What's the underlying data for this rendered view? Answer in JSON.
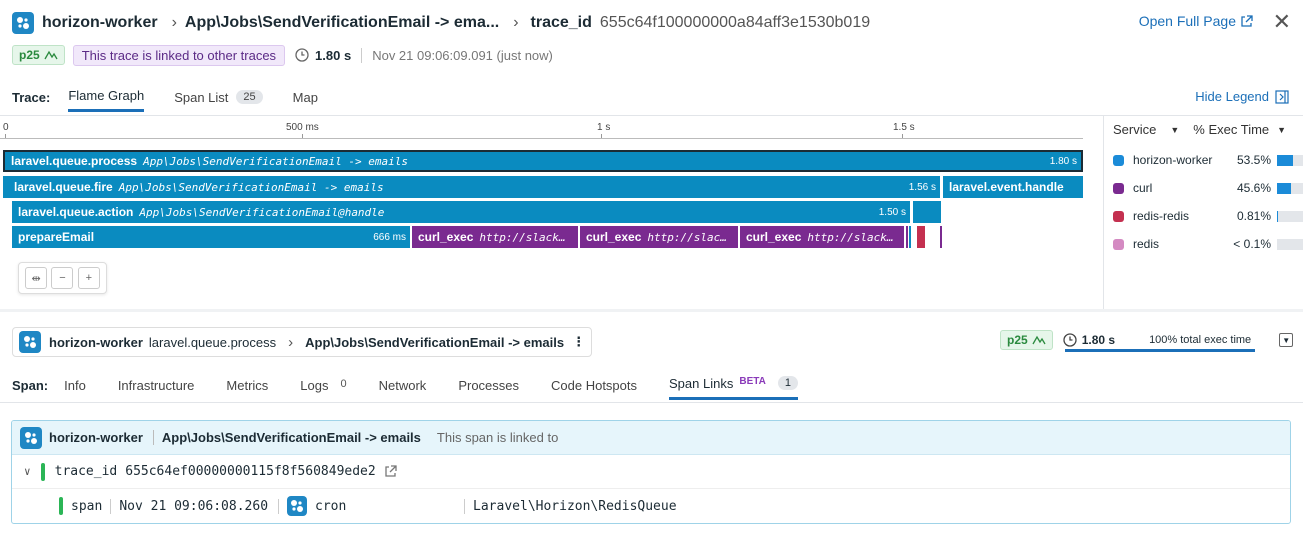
{
  "header": {
    "service": "horizon-worker",
    "resource": "App\\Jobs\\SendVerificationEmail -> ema...",
    "trace_id_label": "trace_id",
    "trace_id": "655c64f100000000a84aff3e1530b019",
    "open_full_page": "Open Full Page"
  },
  "subheader": {
    "percentile": "p25",
    "linked_text": "This trace is linked to other traces",
    "duration": "1.80 s",
    "timestamp": "Nov 21 09:06:09.091 (just now)"
  },
  "tabs": {
    "label": "Trace:",
    "items": [
      "Flame Graph",
      "Span List",
      "Map"
    ],
    "span_list_count": "25",
    "hide_legend": "Hide Legend"
  },
  "flame": {
    "ticks": [
      "0",
      "500 ms",
      "1 s",
      "1.5 s"
    ],
    "rows": [
      {
        "name": "laravel.queue.process",
        "resource": "App\\Jobs\\SendVerificationEmail -> emails",
        "duration": "1.80 s"
      },
      {
        "name": "laravel.queue.fire",
        "resource": "App\\Jobs\\SendVerificationEmail -> emails",
        "duration": "1.56 s"
      },
      {
        "name": "laravel.event.handle",
        "resource": "",
        "duration": ""
      },
      {
        "name": "laravel.queue.action",
        "resource": "App\\Jobs\\SendVerificationEmail@handle",
        "duration": "1.50 s"
      },
      {
        "name": "prepareEmail",
        "resource": "",
        "duration": "666 ms"
      },
      {
        "name": "curl_exec",
        "resource": "http://slack…",
        "duration": ""
      },
      {
        "name": "curl_exec",
        "resource": "http://slac…",
        "duration": ""
      },
      {
        "name": "curl_exec",
        "resource": "http://slack…",
        "duration": ""
      }
    ]
  },
  "legend": {
    "service_header": "Service",
    "pct_header": "% Exec Time",
    "items": [
      {
        "name": "horizon-worker",
        "pct": "53.5%",
        "color": "#1b8bd8",
        "fill": 0.535
      },
      {
        "name": "curl",
        "pct": "45.6%",
        "color": "#7a2a90",
        "fill": 0.456
      },
      {
        "name": "redis-redis",
        "pct": "0.81%",
        "color": "#c43050",
        "fill": 0.008
      },
      {
        "name": "redis",
        "pct": "< 0.1%",
        "color": "#d48ac2",
        "fill": 0.0
      }
    ]
  },
  "span": {
    "service": "horizon-worker",
    "operation": "laravel.queue.process",
    "resource": "App\\Jobs\\SendVerificationEmail -> emails",
    "percentile": "p25",
    "duration": "1.80 s",
    "exec_time": "100% total exec time",
    "tabs_label": "Span:",
    "tabs": [
      "Info",
      "Infrastructure",
      "Metrics",
      "Logs",
      "Network",
      "Processes",
      "Code Hotspots",
      "Span Links"
    ],
    "logs_count": "0",
    "span_links_count": "1",
    "beta": "BETA"
  },
  "links": {
    "service": "horizon-worker",
    "resource": "App\\Jobs\\SendVerificationEmail -> emails",
    "note": "This span is linked to",
    "trace_id_label": "trace_id",
    "trace_id": "655c64ef00000000115f8f560849ede2",
    "span_label": "span",
    "span_time": "Nov 21 09:06:08.260",
    "span_service": "cron",
    "span_resource": "Laravel\\Horizon\\RedisQueue"
  }
}
